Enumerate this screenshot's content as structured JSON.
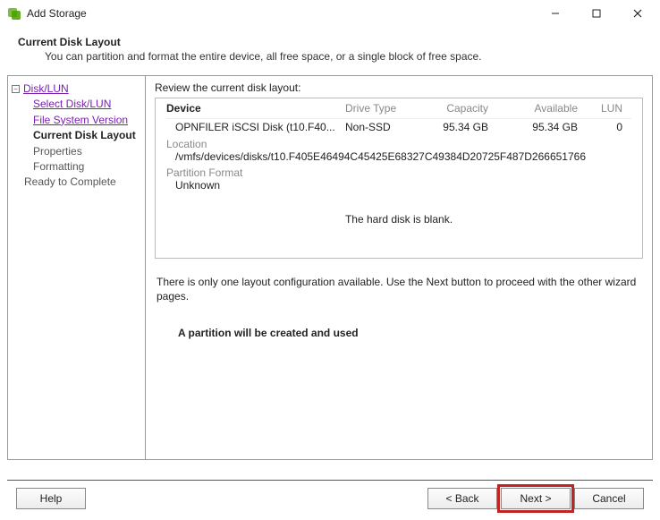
{
  "window": {
    "title": "Add Storage"
  },
  "header": {
    "title": "Current Disk Layout",
    "subtitle": "You can partition and format the entire device, all free space, or a single block of free space."
  },
  "sidebar": {
    "root": "Disk/LUN",
    "items": [
      {
        "label": "Select Disk/LUN",
        "kind": "visited-link"
      },
      {
        "label": "File System Version",
        "kind": "visited-link"
      },
      {
        "label": "Current Disk Layout",
        "kind": "bold"
      },
      {
        "label": "Properties",
        "kind": "muted"
      },
      {
        "label": "Formatting",
        "kind": "muted"
      }
    ],
    "ready": "Ready to Complete"
  },
  "content": {
    "review_label": "Review the current disk layout:",
    "columns": {
      "device": "Device",
      "drive_type": "Drive Type",
      "capacity": "Capacity",
      "available": "Available",
      "lun": "LUN"
    },
    "row": {
      "device": "OPNFILER iSCSI Disk (t10.F40...",
      "drive_type": "Non-SSD",
      "capacity": "95.34 GB",
      "available": "95.34 GB",
      "lun": "0"
    },
    "location_label": "Location",
    "location_value": "/vmfs/devices/disks/t10.F405E46494C45425E68327C49384D20725F487D266651766",
    "pf_label": "Partition Format",
    "pf_value": "Unknown",
    "blank_msg": "The hard disk is blank.",
    "below_text": "There is only one layout configuration available. Use the Next button to proceed with the other wizard pages.",
    "partition_text": "A partition will be created and used"
  },
  "footer": {
    "help": "Help",
    "back": "< Back",
    "next": "Next >",
    "cancel": "Cancel"
  }
}
